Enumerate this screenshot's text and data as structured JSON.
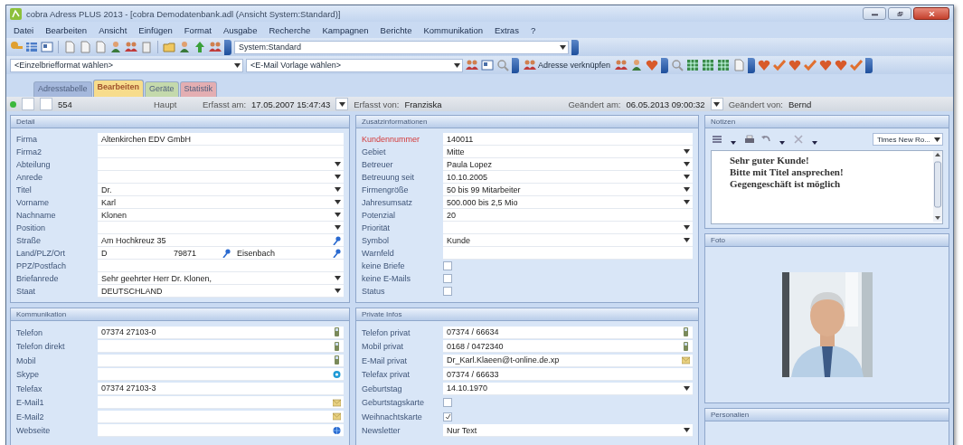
{
  "window": {
    "title": "cobra Adress PLUS 2013 - [cobra Demodatenbank.adl (Ansicht System:Standard)]"
  },
  "menu": [
    {
      "label": "Datei"
    },
    {
      "label": "Bearbeiten"
    },
    {
      "label": "Ansicht"
    },
    {
      "label": "Einfügen"
    },
    {
      "label": "Format"
    },
    {
      "label": "Ausgabe"
    },
    {
      "label": "Recherche"
    },
    {
      "label": "Kampagnen"
    },
    {
      "label": "Berichte"
    },
    {
      "label": "Kommunikation"
    },
    {
      "label": "Extras"
    },
    {
      "label": "?"
    }
  ],
  "toolbar": {
    "view_selector": "System:Standard",
    "letter_template": "<Einzelbriefformat wählen>",
    "email_template": "<E-Mail Vorlage wählen>",
    "link_button": "Adresse verknüpfen"
  },
  "tabs": [
    {
      "label": "Adresstabelle",
      "selected": false,
      "color": "#9fb3d9"
    },
    {
      "label": "Bearbeiten",
      "selected": true,
      "color": "#f7dc8c"
    },
    {
      "label": "Geräte",
      "selected": false,
      "color": "#c4d9a0"
    },
    {
      "label": "Statistik",
      "selected": false,
      "color": "#e8a7a7"
    }
  ],
  "record_bar": {
    "number": "554",
    "type": "Haupt",
    "created_label": "Erfasst am:",
    "created_at": "17.05.2007 15:47:43",
    "created_by_label": "Erfasst von:",
    "created_by": "Franziska",
    "changed_label": "Geändert am:",
    "changed_at": "06.05.2013 09:00:32",
    "changed_by_label": "Geändert von:",
    "changed_by": "Bernd"
  },
  "detail": {
    "title": "Detail",
    "fields": [
      {
        "label": "Firma",
        "kind": "text",
        "value": "Altenkirchen EDV GmbH"
      },
      {
        "label": "Firma2",
        "kind": "text"
      },
      {
        "label": "Abteilung",
        "kind": "dropdown"
      },
      {
        "label": "Anrede",
        "kind": "dropdown"
      },
      {
        "label": "Titel",
        "kind": "dropdown",
        "value": "Dr."
      },
      {
        "label": "Vorname",
        "kind": "dropdown",
        "value": "Karl"
      },
      {
        "label": "Nachname",
        "kind": "dropdown",
        "value": "Klonen"
      },
      {
        "label": "Position",
        "kind": "dropdown"
      },
      {
        "label": "Straße",
        "kind": "lookup",
        "value": "Am Hochkreuz 35"
      },
      {
        "label": "Land/PLZ/Ort",
        "kind": "address",
        "country": "D",
        "zip": "79871",
        "city": "Eisenbach"
      },
      {
        "label": "PPZ/Postfach",
        "kind": "text"
      },
      {
        "label": "Briefanrede",
        "kind": "dropdown",
        "value": "Sehr geehrter Herr Dr. Klonen,"
      },
      {
        "label": "Staat",
        "kind": "dropdown",
        "value": "DEUTSCHLAND"
      }
    ]
  },
  "additional": {
    "title": "Zusatzinformationen",
    "fields": [
      {
        "label": "Kundennummer",
        "kind": "text",
        "value": "140011",
        "required": true
      },
      {
        "label": "Gebiet",
        "kind": "dropdown",
        "value": "Mitte"
      },
      {
        "label": "Betreuer",
        "kind": "dropdown",
        "value": "Paula Lopez"
      },
      {
        "label": "Betreuung seit",
        "kind": "dropdown",
        "value": "10.10.2005"
      },
      {
        "label": "Firmengröße",
        "kind": "dropdown",
        "value": "50 bis 99 Mitarbeiter"
      },
      {
        "label": "Jahresumsatz",
        "kind": "dropdown",
        "value": "500.000 bis 2,5 Mio"
      },
      {
        "label": "Potenzial",
        "kind": "text",
        "value": "20"
      },
      {
        "label": "Priorität",
        "kind": "dropdown"
      },
      {
        "label": "Symbol",
        "kind": "dropdown",
        "value": "Kunde"
      },
      {
        "label": "Warnfeld",
        "kind": "text"
      },
      {
        "label": "keine Briefe",
        "kind": "checkbox",
        "checked": false
      },
      {
        "label": "keine E-Mails",
        "kind": "checkbox",
        "checked": false
      },
      {
        "label": "Status",
        "kind": "checkbox",
        "checked": false
      }
    ]
  },
  "communication": {
    "title": "Kommunikation",
    "fields": [
      {
        "label": "Telefon",
        "kind": "phone",
        "value": "07374 27103-0"
      },
      {
        "label": "Telefon direkt",
        "kind": "phone"
      },
      {
        "label": "Mobil",
        "kind": "phone"
      },
      {
        "label": "Skype",
        "kind": "skype"
      },
      {
        "label": "Telefax",
        "kind": "text",
        "value": "07374 27103-3"
      },
      {
        "label": "E-Mail1",
        "kind": "mail"
      },
      {
        "label": "E-Mail2",
        "kind": "mail"
      },
      {
        "label": "Webseite",
        "kind": "web"
      }
    ]
  },
  "private": {
    "title": "Private Infos",
    "fields": [
      {
        "label": "Telefon privat",
        "kind": "phone",
        "value": "07374 / 66634"
      },
      {
        "label": "Mobil privat",
        "kind": "phone",
        "value": "0168 / 0472340"
      },
      {
        "label": "E-Mail privat",
        "kind": "mail",
        "value": "Dr_Karl.Klaeen@t-online.de.xp"
      },
      {
        "label": "Telefax privat",
        "kind": "text",
        "value": "07374 / 66633"
      },
      {
        "label": "Geburtstag",
        "kind": "dropdown",
        "value": "14.10.1970"
      },
      {
        "label": "Geburtstagskarte",
        "kind": "checkbox",
        "checked": false
      },
      {
        "label": "Weihnachtskarte",
        "kind": "checkbox",
        "checked": true
      },
      {
        "label": "Newsletter",
        "kind": "dropdown",
        "value": "Nur Text"
      }
    ]
  },
  "notes": {
    "title": "Notizen",
    "font_selector": "Times New Ro...",
    "lines": [
      "Sehr guter Kunde!",
      "Bitte mit Titel ansprechen!",
      "Gegengeschäft ist möglich"
    ]
  },
  "photo": {
    "title": "Foto",
    "kind": "picture"
  },
  "personal": {
    "title": "Personalien"
  }
}
